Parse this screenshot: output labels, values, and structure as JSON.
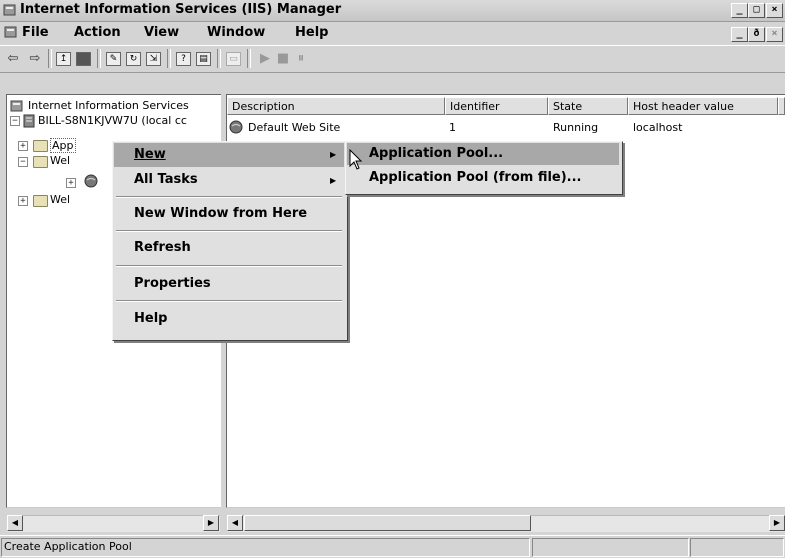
{
  "window": {
    "title": "Internet Information Services (IIS) Manager",
    "controls": [
      "_",
      "□",
      "×"
    ],
    "doc_controls": [
      "_",
      "ð",
      "×"
    ]
  },
  "menubar": {
    "items": [
      "File",
      "Action",
      "View",
      "Window",
      "Help"
    ]
  },
  "tree": {
    "root": "Internet Information Services",
    "server": "BILL-S8N1KJVW7U (local cc",
    "child1": "App",
    "child2": "Wel",
    "child4": "Wel"
  },
  "list": {
    "columns": [
      "Description",
      "Identifier",
      "State",
      "Host header value"
    ],
    "rows": [
      {
        "description": "Default Web Site",
        "identifier": "1",
        "state": "Running",
        "host": "localhost"
      }
    ]
  },
  "context_menu": {
    "items": [
      "New",
      "All Tasks",
      "New Window from Here",
      "Refresh",
      "Properties",
      "Help"
    ]
  },
  "submenu": {
    "items": [
      "Application Pool...",
      "Application Pool (from file)..."
    ]
  },
  "status": {
    "text": "Create Application Pool"
  },
  "colors": {
    "menu_highlight": "#a8a8a8",
    "chrome": "#d4d4d4"
  }
}
